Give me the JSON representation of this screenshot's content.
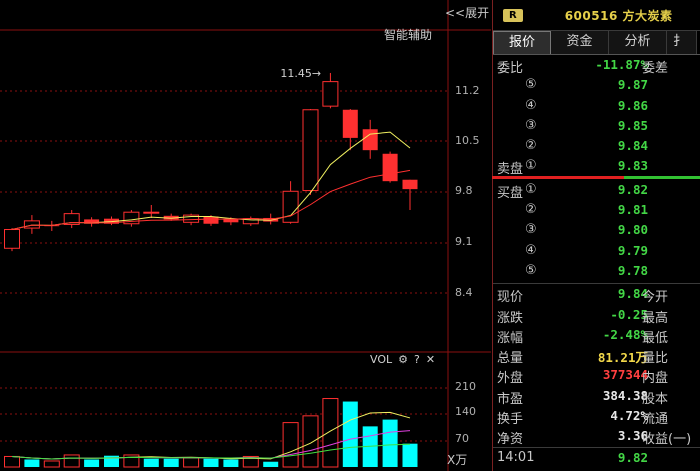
{
  "toolbar": {
    "expand_label": "<<展开",
    "assist_label": "智能辅助",
    "vol_label": "VOL",
    "gear_icon": "⚙",
    "help_icon": "?",
    "close_icon": "✕",
    "unit_label": "X万"
  },
  "price_axis": [
    "11.2",
    "10.5",
    "9.8",
    "9.1",
    "8.4"
  ],
  "vol_axis": [
    "210",
    "140",
    "70"
  ],
  "annotation": {
    "high": "11.45"
  },
  "stock": {
    "badge": "R",
    "code_name": "600516 方大炭素"
  },
  "tabs": [
    "报价",
    "资金",
    "分析",
    "扌"
  ],
  "orderbook": {
    "ratio_label": "委比",
    "ratio_value": "-11.87%",
    "diff_label": "委差",
    "sell": [
      {
        "label": "",
        "num": "⑤",
        "price": "9.87"
      },
      {
        "label": "",
        "num": "④",
        "price": "9.86"
      },
      {
        "label": "",
        "num": "③",
        "price": "9.85"
      },
      {
        "label": "",
        "num": "②",
        "price": "9.84"
      },
      {
        "label": "卖盘",
        "num": "①",
        "price": "9.83"
      }
    ],
    "buy": [
      {
        "label": "买盘",
        "num": "①",
        "price": "9.82"
      },
      {
        "label": "",
        "num": "②",
        "price": "9.81"
      },
      {
        "label": "",
        "num": "③",
        "price": "9.80"
      },
      {
        "label": "",
        "num": "④",
        "price": "9.79"
      },
      {
        "label": "",
        "num": "⑤",
        "price": "9.78"
      }
    ]
  },
  "stats": [
    {
      "label": "现价",
      "value": "9.84",
      "color": "green",
      "label2": "今开"
    },
    {
      "label": "涨跌",
      "value": "-0.25",
      "color": "green",
      "label2": "最高"
    },
    {
      "label": "涨幅",
      "value": "-2.48%",
      "color": "green",
      "label2": "最低"
    },
    {
      "label": "总量",
      "value": "81.21万",
      "color": "yellow",
      "label2": "量比"
    },
    {
      "label": "外盘",
      "value": "377344",
      "color": "red",
      "label2": "内盘"
    },
    {
      "label": "市盈",
      "value": "384.38",
      "color": "white",
      "label2": "股本"
    },
    {
      "label": "换手",
      "value": "4.72%",
      "color": "white",
      "label2": "流通"
    },
    {
      "label": "净资",
      "value": "3.36",
      "color": "white",
      "label2": "收益(一)"
    }
  ],
  "ticks": [
    {
      "time": "14:01",
      "value": "9.82"
    },
    {
      "time": "14:01",
      "value": "9.82"
    }
  ],
  "candles": [
    {
      "o": 9.02,
      "c": 9.28,
      "h": 9.3,
      "l": 8.98
    },
    {
      "o": 9.3,
      "c": 9.4,
      "h": 9.48,
      "l": 9.22
    },
    {
      "o": 9.34,
      "c": 9.33,
      "h": 9.4,
      "l": 9.26
    },
    {
      "o": 9.35,
      "c": 9.5,
      "h": 9.55,
      "l": 9.3
    },
    {
      "o": 9.42,
      "c": 9.36,
      "h": 9.45,
      "l": 9.32
    },
    {
      "o": 9.43,
      "c": 9.36,
      "h": 9.46,
      "l": 9.34
    },
    {
      "o": 9.36,
      "c": 9.52,
      "h": 9.55,
      "l": 9.32
    },
    {
      "o": 9.52,
      "c": 9.52,
      "h": 9.62,
      "l": 9.44
    },
    {
      "o": 9.47,
      "c": 9.42,
      "h": 9.5,
      "l": 9.4
    },
    {
      "o": 9.38,
      "c": 9.48,
      "h": 9.5,
      "l": 9.34
    },
    {
      "o": 9.46,
      "c": 9.36,
      "h": 9.48,
      "l": 9.33
    },
    {
      "o": 9.43,
      "c": 9.38,
      "h": 9.45,
      "l": 9.34
    },
    {
      "o": 9.36,
      "c": 9.43,
      "h": 9.46,
      "l": 9.33
    },
    {
      "o": 9.44,
      "c": 9.39,
      "h": 9.5,
      "l": 9.35
    },
    {
      "o": 9.38,
      "c": 9.81,
      "h": 9.95,
      "l": 9.36
    },
    {
      "o": 9.82,
      "c": 10.94,
      "h": 10.95,
      "l": 9.76
    },
    {
      "o": 10.99,
      "c": 11.33,
      "h": 11.45,
      "l": 10.96
    },
    {
      "o": 10.94,
      "c": 10.55,
      "h": 10.95,
      "l": 10.38
    },
    {
      "o": 10.67,
      "c": 10.38,
      "h": 10.8,
      "l": 10.26
    },
    {
      "o": 10.33,
      "c": 9.95,
      "h": 10.36,
      "l": 9.93
    },
    {
      "o": 9.97,
      "c": 9.84,
      "h": 9.97,
      "l": 9.55
    }
  ],
  "volumes": [
    {
      "v": 28,
      "up": true
    },
    {
      "v": 20,
      "up": false
    },
    {
      "v": 16,
      "up": true
    },
    {
      "v": 32,
      "up": true
    },
    {
      "v": 20,
      "up": false
    },
    {
      "v": 30,
      "up": false
    },
    {
      "v": 32,
      "up": true
    },
    {
      "v": 22,
      "up": false
    },
    {
      "v": 22,
      "up": false
    },
    {
      "v": 24,
      "up": true
    },
    {
      "v": 22,
      "up": false
    },
    {
      "v": 20,
      "up": false
    },
    {
      "v": 28,
      "up": true
    },
    {
      "v": 14,
      "up": false
    },
    {
      "v": 118,
      "up": true
    },
    {
      "v": 136,
      "up": true
    },
    {
      "v": 182,
      "up": true
    },
    {
      "v": 174,
      "up": false
    },
    {
      "v": 108,
      "up": false
    },
    {
      "v": 126,
      "up": false
    },
    {
      "v": 62,
      "up": false
    }
  ]
}
